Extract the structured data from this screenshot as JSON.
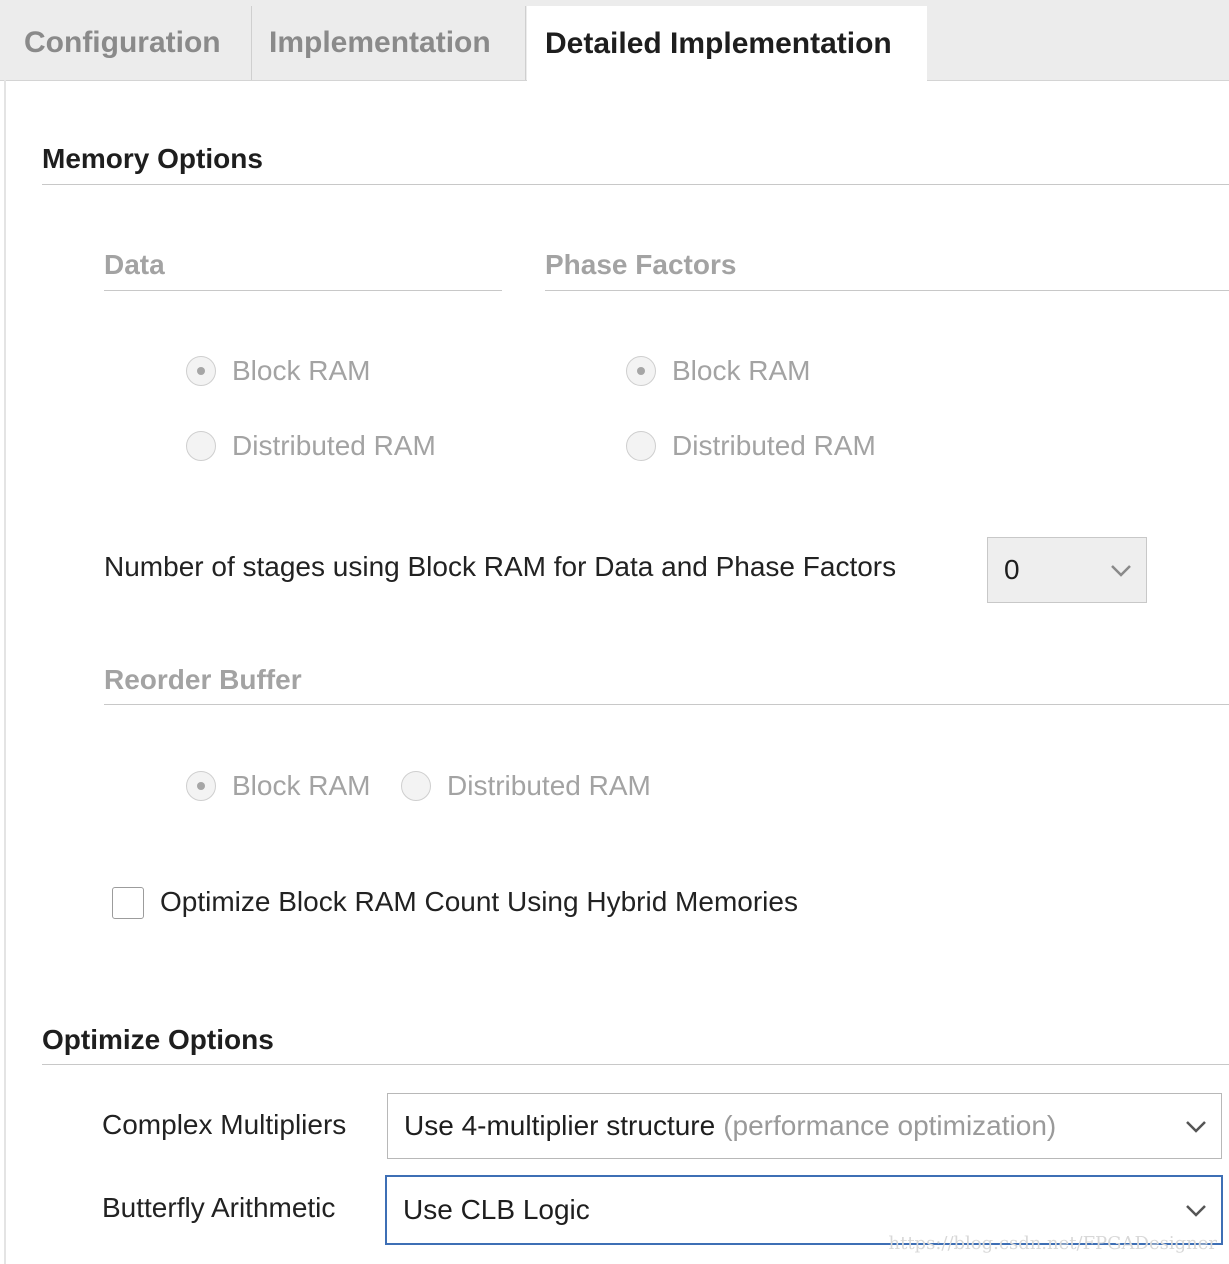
{
  "tabs": [
    {
      "label": "Configuration",
      "active": false
    },
    {
      "label": "Implementation",
      "active": false
    },
    {
      "label": "Detailed Implementation",
      "active": true
    }
  ],
  "memory_options": {
    "title": "Memory Options",
    "data": {
      "title": "Data",
      "options": [
        {
          "label": "Block RAM",
          "selected": true
        },
        {
          "label": "Distributed RAM",
          "selected": false
        }
      ]
    },
    "phase_factors": {
      "title": "Phase Factors",
      "options": [
        {
          "label": "Block RAM",
          "selected": true
        },
        {
          "label": "Distributed RAM",
          "selected": false
        }
      ]
    },
    "stages": {
      "label": "Number of stages using Block RAM for Data and Phase Factors",
      "value": "0"
    },
    "reorder_buffer": {
      "title": "Reorder Buffer",
      "options": [
        {
          "label": "Block RAM",
          "selected": true
        },
        {
          "label": "Distributed RAM",
          "selected": false
        }
      ]
    },
    "hybrid": {
      "label": "Optimize Block RAM Count Using Hybrid Memories",
      "checked": false
    }
  },
  "optimize_options": {
    "title": "Optimize Options",
    "complex_multipliers": {
      "label": "Complex Multipliers",
      "value": "Use 4-multiplier structure",
      "hint": "(performance optimization)"
    },
    "butterfly_arithmetic": {
      "label": "Butterfly Arithmetic",
      "value": "Use CLB Logic"
    }
  },
  "watermark": "https://blog.csdn.net/FPGADesigner",
  "colors": {
    "accent_focus": "#3e6fb5",
    "disabled_text": "#a3a3a3"
  }
}
